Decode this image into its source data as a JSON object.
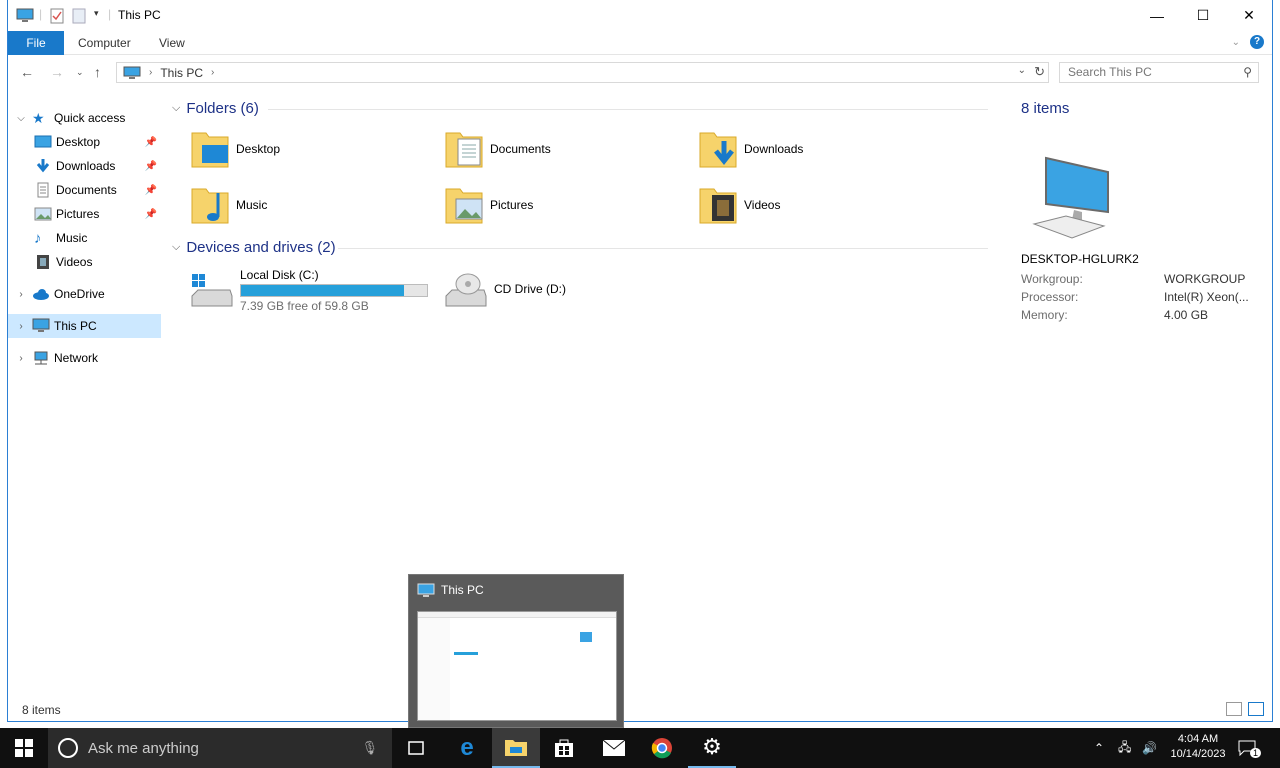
{
  "window": {
    "title": "This PC",
    "minimize_glyph": "—",
    "maximize_glyph": "☐",
    "close_glyph": "✕"
  },
  "ribbon": {
    "tabs": [
      "File",
      "Computer",
      "View"
    ]
  },
  "address": {
    "crumb": "This PC",
    "search_placeholder": "Search This PC"
  },
  "nav": {
    "items": [
      {
        "label": "Quick access",
        "icon": "star-icon"
      },
      {
        "label": "Desktop",
        "icon": "desktop-icon"
      },
      {
        "label": "Downloads",
        "icon": "downloads-icon"
      },
      {
        "label": "Documents",
        "icon": "documents-icon"
      },
      {
        "label": "Pictures",
        "icon": "pictures-icon"
      },
      {
        "label": "Music",
        "icon": "music-icon"
      },
      {
        "label": "Videos",
        "icon": "videos-icon"
      },
      {
        "label": "OneDrive",
        "icon": "onedrive-icon"
      },
      {
        "label": "This PC",
        "icon": "computer-icon"
      },
      {
        "label": "Network",
        "icon": "network-icon"
      }
    ]
  },
  "content": {
    "folders_heading": "Folders (6)",
    "folders": [
      "Desktop",
      "Documents",
      "Downloads",
      "Music",
      "Pictures",
      "Videos"
    ],
    "drives_heading": "Devices and drives (2)",
    "drives": [
      {
        "name": "Local Disk (C:)",
        "free": "7.39 GB free of 59.8 GB",
        "used_fraction": 0.876
      },
      {
        "name": "CD Drive (D:)"
      }
    ]
  },
  "details": {
    "count": "8 items",
    "computer_name": "DESKTOP-HGLURK2",
    "rows": [
      {
        "label": "Workgroup:",
        "value": "WORKGROUP"
      },
      {
        "label": "Processor:",
        "value": "Intel(R) Xeon(..."
      },
      {
        "label": "Memory:",
        "value": "4.00 GB"
      }
    ]
  },
  "status": {
    "count": "8 items"
  },
  "thumbnail": {
    "title": "This PC"
  },
  "taskbar": {
    "search_placeholder": "Ask me anything",
    "time": "4:04 AM",
    "date": "10/14/2023",
    "notification_count": "1"
  },
  "colors": {
    "accent": "#1979ca",
    "selection": "#cce8ff",
    "heading": "#1e3287",
    "drive_bar": "#26a0da",
    "taskbar": "#101010"
  }
}
